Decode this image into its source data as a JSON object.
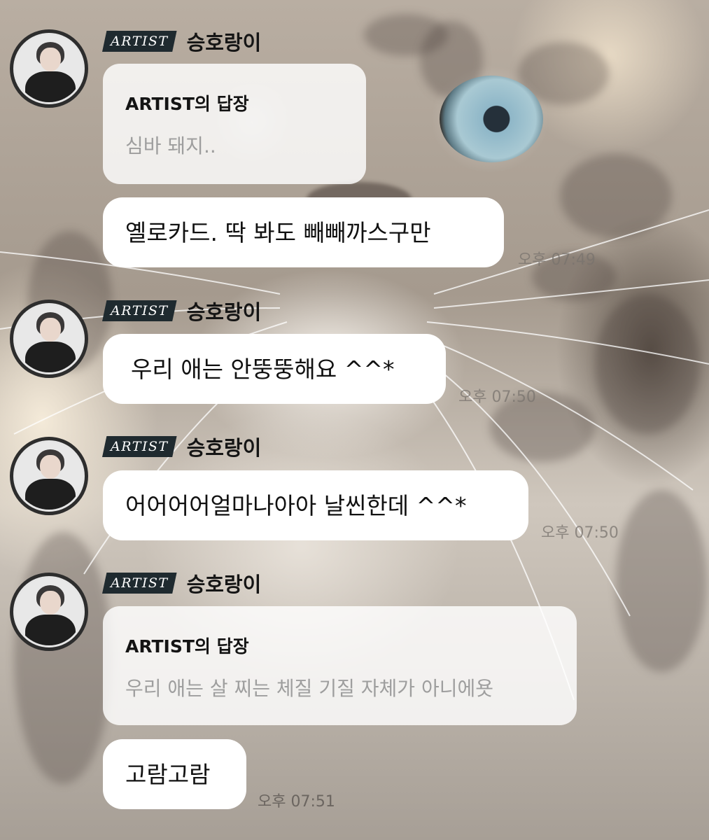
{
  "sender": {
    "badge": "ARTIST",
    "name": "승호랑이"
  },
  "messages": [
    {
      "reply": {
        "title": "ARTIST의 답장",
        "quoted": "심바 돼지.."
      },
      "text": "옐로카드.  딱 봐도 빼빼까스구만",
      "time": "오후 07:49"
    },
    {
      "text": "우리 애는 안뚱뚱해요 ^^*",
      "time": "오후 07:50"
    },
    {
      "text": "어어어어얼마나아아 날씬한데 ^^*",
      "time": "오후 07:50"
    },
    {
      "reply": {
        "title": "ARTIST의 답장",
        "quoted": "우리 애는 살 찌는 체질 기질 자체가 아니에욧"
      },
      "text": "고람고람",
      "time": "오후 07:51"
    }
  ]
}
